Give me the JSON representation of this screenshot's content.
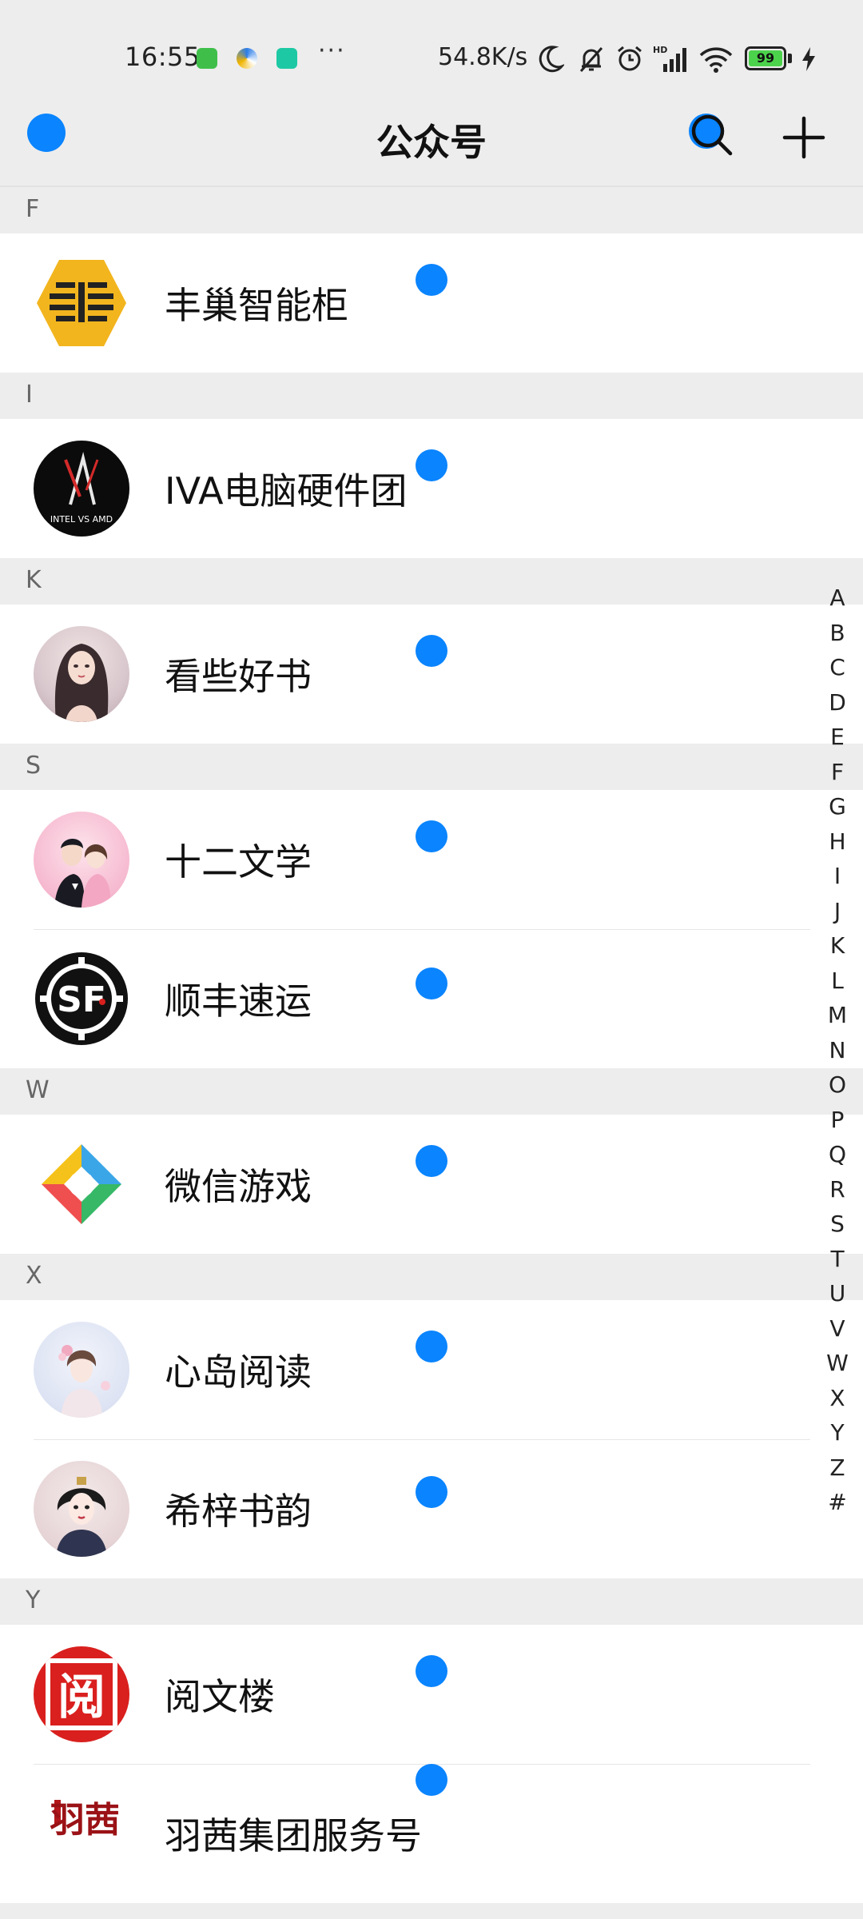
{
  "status_bar": {
    "time": "16:55",
    "dots": "···",
    "network_speed": "54.8K/s",
    "battery_level": "99",
    "icons": [
      "app-icon-green",
      "app-icon-swirl",
      "app-icon-shield",
      "moon-icon",
      "bell-off-icon",
      "alarm-icon",
      "signal-hd-icon",
      "wifi-icon",
      "battery-icon",
      "charging-bolt-icon"
    ]
  },
  "nav": {
    "title": "公众号",
    "left_icon": "back-icon",
    "right_icons": [
      "search-icon",
      "add-icon"
    ]
  },
  "sections": [
    {
      "letter": "F",
      "items": [
        {
          "name": "丰巢智能柜",
          "avatar": "fengchao-logo"
        }
      ]
    },
    {
      "letter": "I",
      "items": [
        {
          "name": "IVA电脑硬件团",
          "avatar": "iva-logo",
          "avatar_text": "INTEL VS AMD"
        }
      ]
    },
    {
      "letter": "K",
      "items": [
        {
          "name": "看些好书",
          "avatar": "portrait-woman"
        }
      ]
    },
    {
      "letter": "S",
      "items": [
        {
          "name": "十二文学",
          "avatar": "portrait-couple"
        },
        {
          "name": "顺丰速运",
          "avatar": "sf-logo",
          "avatar_text": "SF"
        }
      ]
    },
    {
      "letter": "W",
      "items": [
        {
          "name": "微信游戏",
          "avatar": "wechat-game-logo"
        }
      ]
    },
    {
      "letter": "X",
      "items": [
        {
          "name": "心岛阅读",
          "avatar": "portrait-lady-flowers"
        },
        {
          "name": "希梓书韵",
          "avatar": "portrait-lady-traditional"
        }
      ]
    },
    {
      "letter": "Y",
      "items": [
        {
          "name": "阅文楼",
          "avatar": "yuewen-logo",
          "avatar_text": "阅"
        },
        {
          "name": "羽茜集团服务号",
          "avatar": "yuxi-calligraphy",
          "avatar_text": "羽茜"
        }
      ]
    }
  ],
  "index_letters": [
    "A",
    "B",
    "C",
    "D",
    "E",
    "F",
    "G",
    "H",
    "I",
    "J",
    "K",
    "L",
    "M",
    "N",
    "O",
    "P",
    "Q",
    "R",
    "S",
    "T",
    "U",
    "V",
    "W",
    "X",
    "Y",
    "Z",
    "#"
  ],
  "colors": {
    "accent_blue": "#0a84ff",
    "page_bg": "#ededed",
    "row_bg": "#ffffff",
    "fengchao_yellow": "#f2b51e",
    "sf_black": "#111111",
    "yuewen_red": "#d9201e"
  }
}
